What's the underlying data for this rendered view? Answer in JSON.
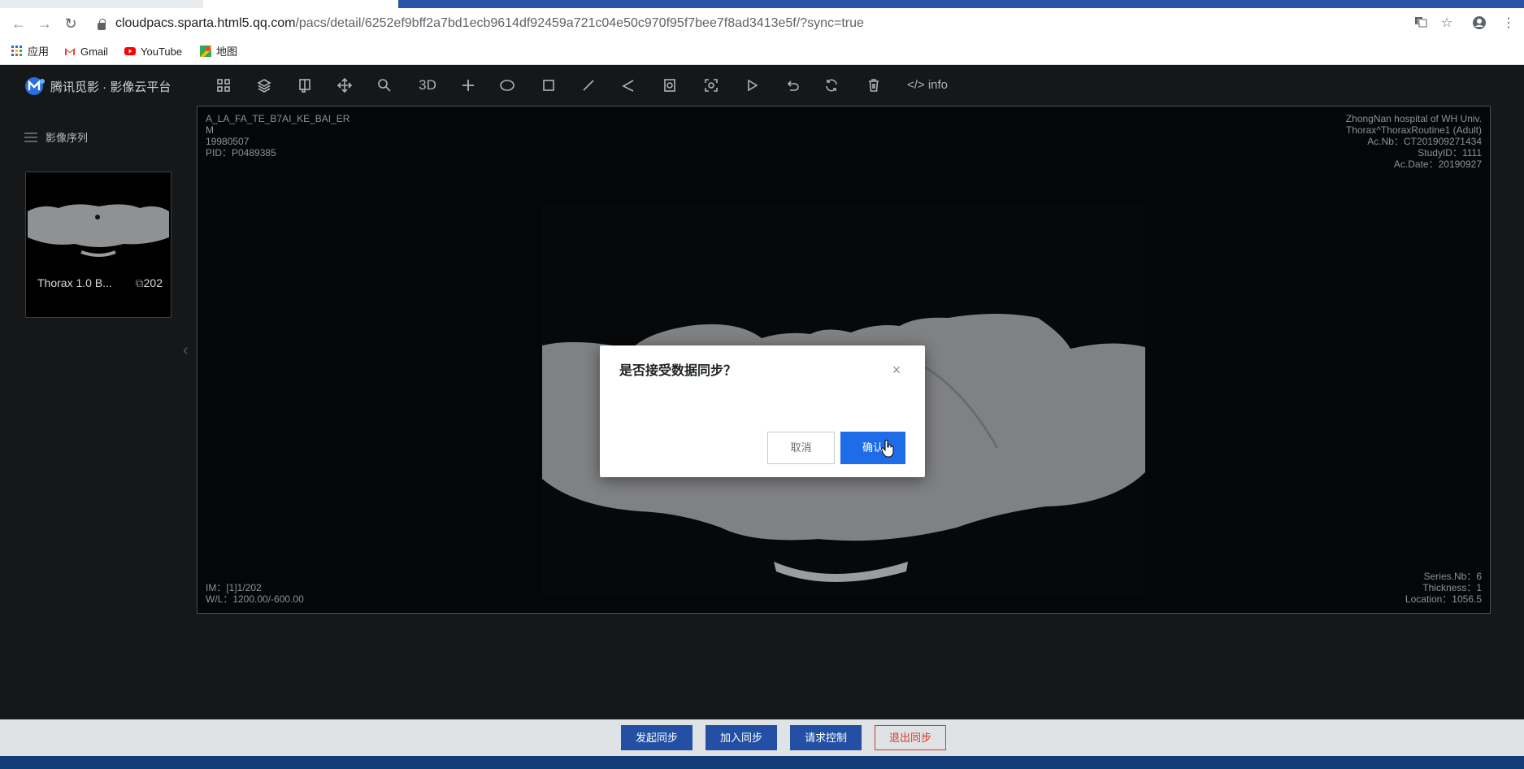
{
  "browser": {
    "url_host": "cloudpacs.sparta.html5.qq.com",
    "url_path": "/pacs/detail/6252ef9bff2a7bd1ecb9614df92459a721c04e50c970f95f7bee7f8ad3413e5f/?sync=true",
    "bookmarks": [
      {
        "label": "应用",
        "icon": "apps-grid-icon"
      },
      {
        "label": "Gmail",
        "icon": "gmail-icon"
      },
      {
        "label": "YouTube",
        "icon": "youtube-icon"
      },
      {
        "label": "地图",
        "icon": "maps-icon"
      }
    ]
  },
  "app": {
    "logo_text": "腾讯觅影 · 影像云平台",
    "toolbar": {
      "tools": [
        "grid-layout",
        "layers",
        "window-level",
        "pan",
        "zoom",
        "3D",
        "crosshair",
        "ellipse",
        "rectangle",
        "line",
        "angle",
        "roi",
        "screenshot",
        "play",
        "undo",
        "reset",
        "delete",
        "info"
      ],
      "label_3d": "3D",
      "label_info": "info"
    },
    "sidebar": {
      "title": "影像序列",
      "series": [
        {
          "name": "Thorax 1.0 B...",
          "count": "202"
        }
      ]
    },
    "viewer": {
      "top_left": [
        "A_LA_FA_TE_B7AI_KE_BAI_ER",
        "M",
        "19980507",
        "PID：P0489385"
      ],
      "top_right": [
        "ZhongNan hospital of WH Univ.",
        "Thorax^ThoraxRoutine1 (Adult)",
        "Ac.Nb：CT201909271434",
        "StudyID：1111",
        "Ac.Date：20190927"
      ],
      "bottom_left": [
        "IM：[1]1/202",
        "W/L：1200.00/-600.00"
      ],
      "bottom_right": [
        "Series.Nb：6",
        "Thickness：1",
        "Location：1056.5"
      ]
    },
    "dialog": {
      "title": "是否接受数据同步？",
      "cancel": "取消",
      "confirm": "确认"
    },
    "sync_bar": {
      "start": "发起同步",
      "join": "加入同步",
      "request": "请求控制",
      "exit": "退出同步"
    }
  },
  "colors": {
    "accent": "#1e6ce8",
    "sync_primary": "#2350a5",
    "sync_danger": "#d6392e",
    "viewer_bg": "#050607"
  }
}
